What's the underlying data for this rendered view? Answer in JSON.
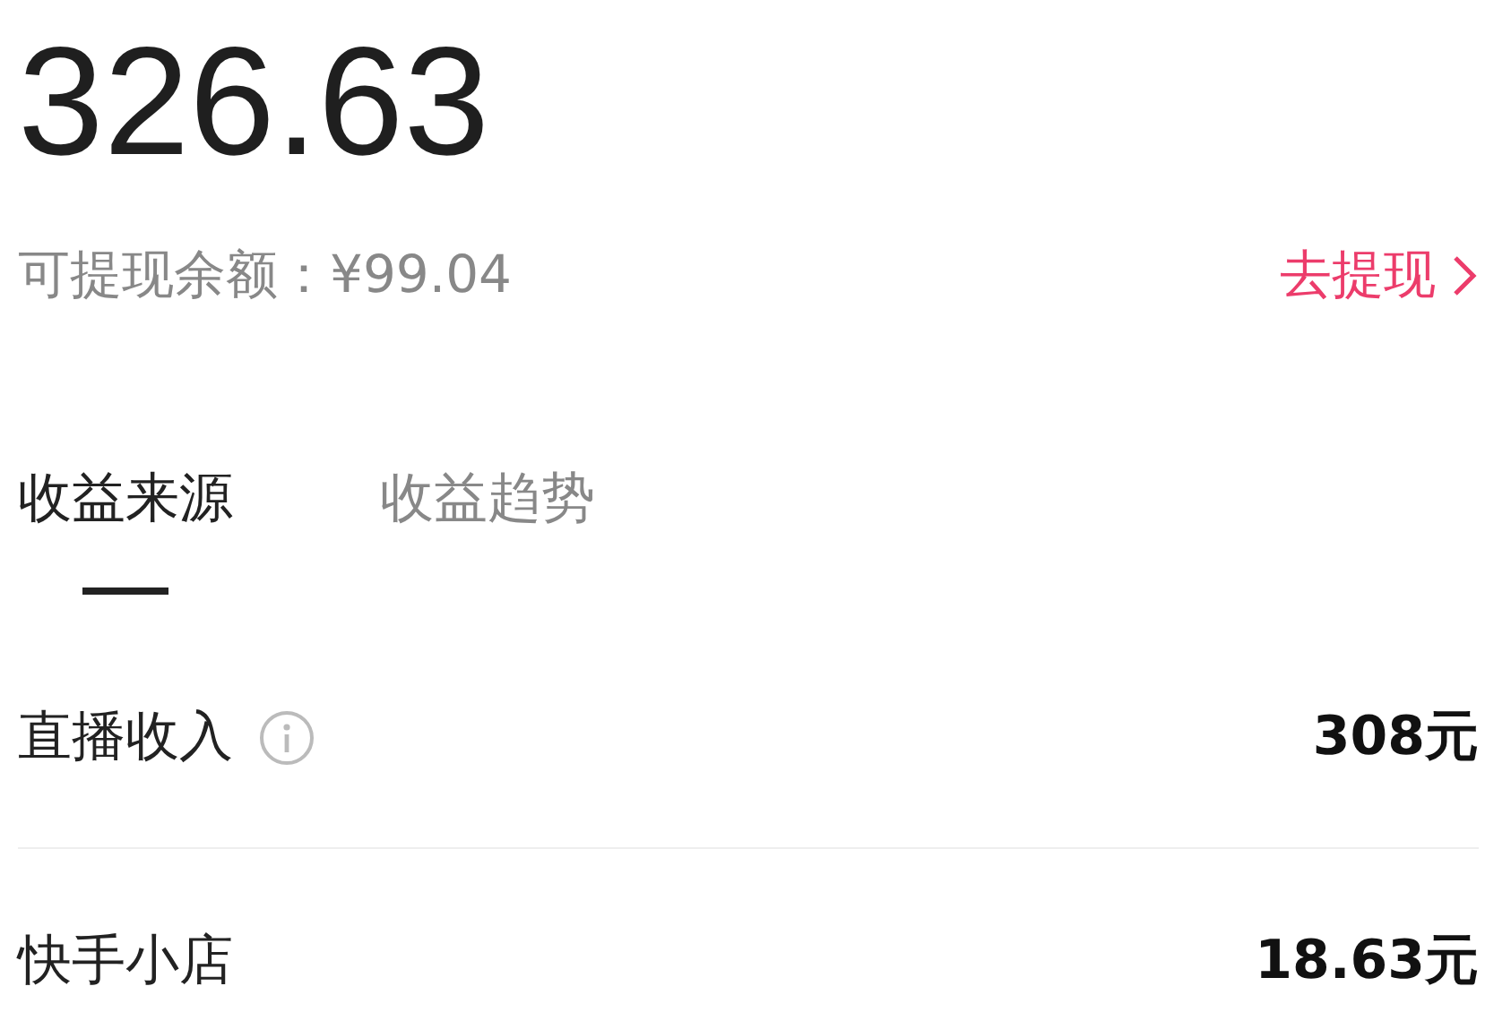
{
  "total": "326.63",
  "withdrawable": {
    "label": "可提现余额：¥99.04",
    "action": "去提现"
  },
  "tabs": [
    {
      "label": "收益来源",
      "selected": true
    },
    {
      "label": "收益趋势",
      "selected": false
    }
  ],
  "rows": [
    {
      "label": "直播收入",
      "info": true,
      "value": "308元"
    },
    {
      "label": "快手小店",
      "value": "18.63元"
    }
  ]
}
